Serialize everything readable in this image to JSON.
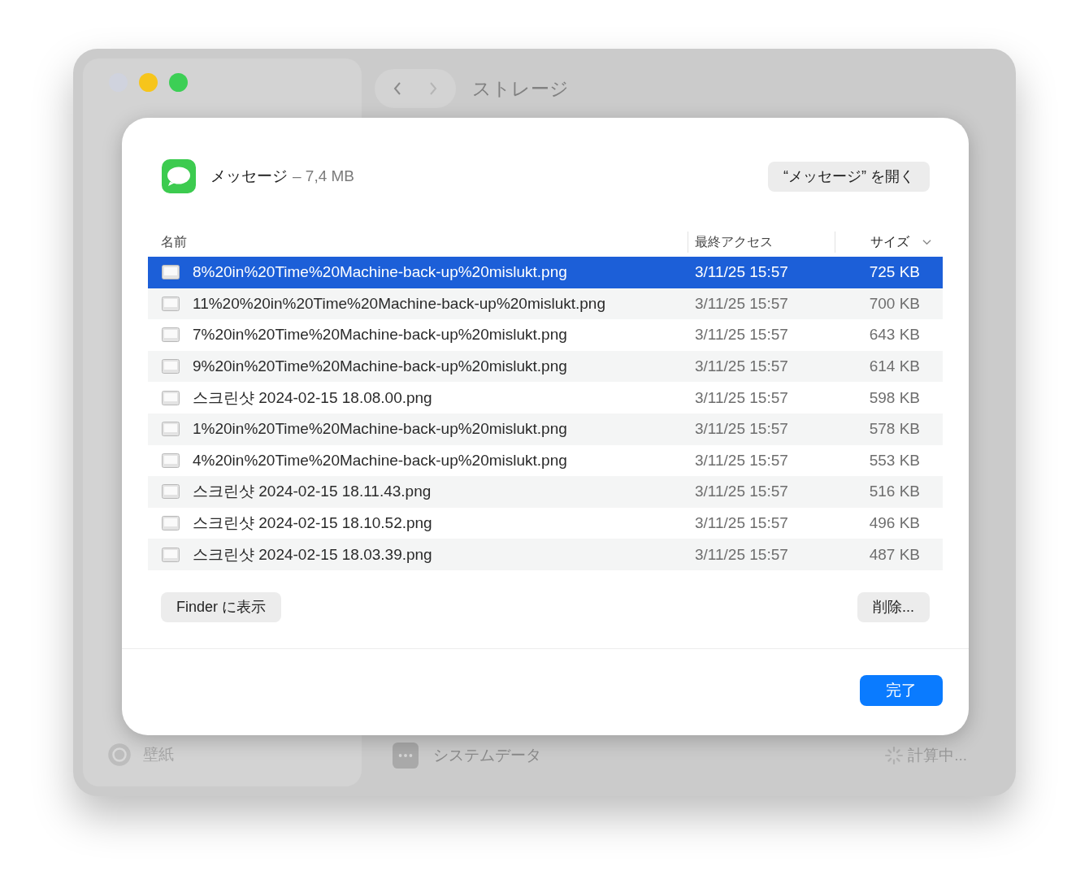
{
  "window": {
    "title": "ストレージ"
  },
  "sidebar": {
    "items": [
      {
        "label": "壁紙"
      }
    ]
  },
  "main": {
    "rows": [
      {
        "name": "システムデータ",
        "size": "計算中..."
      }
    ]
  },
  "dialog": {
    "app_name": "メッセージ",
    "app_size": "– 7,4 MB",
    "open_button": "“メッセージ” を開く",
    "columns": [
      {
        "label": "名前",
        "sorted": false
      },
      {
        "label": "最終アクセス",
        "sorted": false
      },
      {
        "label": "サイズ",
        "sorted": true
      }
    ],
    "rows": [
      {
        "name": "8%20in%20Time%20Machine-back-up%20mislukt.png",
        "last_access": "3/11/25 15:57",
        "size": "725 KB",
        "selected": true
      },
      {
        "name": "11%20%20in%20Time%20Machine-back-up%20mislukt.png",
        "last_access": "3/11/25 15:57",
        "size": "700 KB",
        "selected": false
      },
      {
        "name": "7%20in%20Time%20Machine-back-up%20mislukt.png",
        "last_access": "3/11/25 15:57",
        "size": "643 KB",
        "selected": false
      },
      {
        "name": "9%20in%20Time%20Machine-back-up%20mislukt.png",
        "last_access": "3/11/25 15:57",
        "size": "614 KB",
        "selected": false
      },
      {
        "name": "스크린샷 2024-02-15 18.08.00.png",
        "last_access": "3/11/25 15:57",
        "size": "598 KB",
        "selected": false
      },
      {
        "name": "1%20in%20Time%20Machine-back-up%20mislukt.png",
        "last_access": "3/11/25 15:57",
        "size": "578 KB",
        "selected": false
      },
      {
        "name": "4%20in%20Time%20Machine-back-up%20mislukt.png",
        "last_access": "3/11/25 15:57",
        "size": "553 KB",
        "selected": false
      },
      {
        "name": "스크린샷 2024-02-15 18.11.43.png",
        "last_access": "3/11/25 15:57",
        "size": "516 KB",
        "selected": false
      },
      {
        "name": "스크린샷 2024-02-15 18.10.52.png",
        "last_access": "3/11/25 15:57",
        "size": "496 KB",
        "selected": false
      },
      {
        "name": "스크린샷 2024-02-15 18.03.39.png",
        "last_access": "3/11/25 15:57",
        "size": "487 KB",
        "selected": false
      }
    ],
    "finder_button": "Finder に表示",
    "delete_button": "削除...",
    "done_button": "完了"
  }
}
